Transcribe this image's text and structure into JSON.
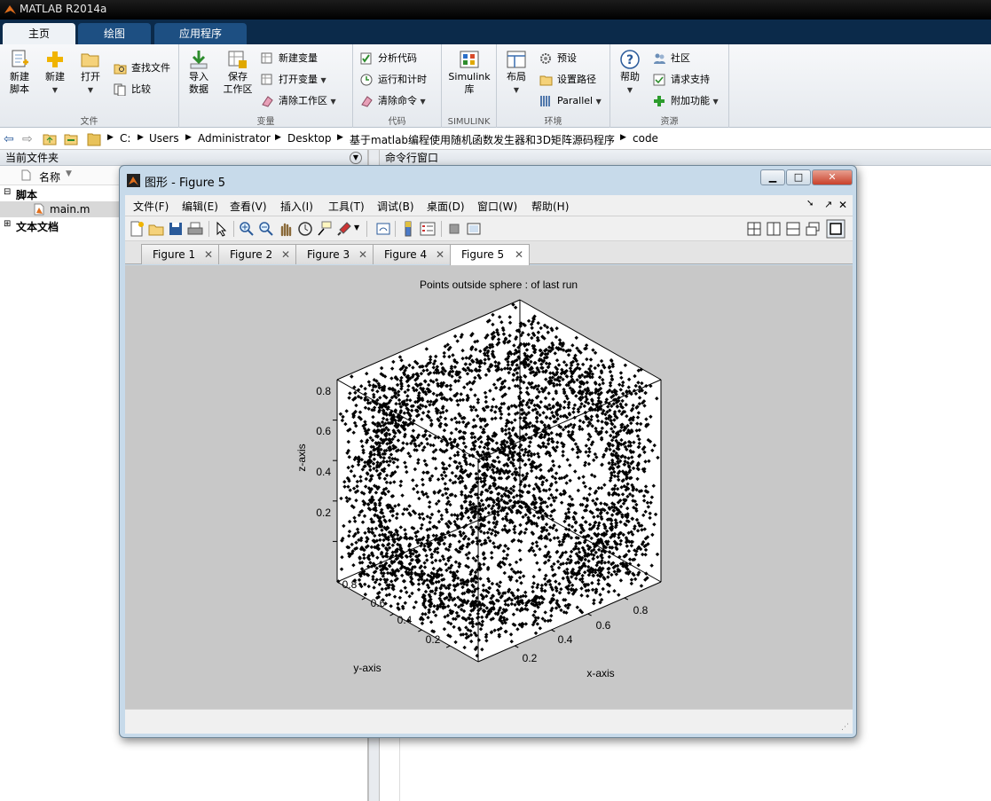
{
  "app": {
    "title": "MATLAB R2014a"
  },
  "ribbon": {
    "tabs": [
      "主页",
      "绘图",
      "应用程序"
    ],
    "groups": {
      "file": {
        "label": "文件",
        "new_script": "新建\n脚本",
        "new": "新建",
        "open": "打开",
        "find_files": "查找文件",
        "compare": "比较"
      },
      "variable": {
        "label": "变量",
        "import": "导入\n数据",
        "save": "保存\n工作区",
        "new_var": "新建变量",
        "open_var": "打开变量",
        "clear_ws": "清除工作区"
      },
      "code": {
        "label": "代码",
        "analyze": "分析代码",
        "run_time": "运行和计时",
        "clear_cmd": "清除命令"
      },
      "simulink": {
        "label": "SIMULINK",
        "library": "Simulink\n库"
      },
      "env": {
        "label": "环境",
        "layout": "布局",
        "prefs": "预设",
        "set_path": "设置路径",
        "parallel": "Parallel"
      },
      "resources": {
        "label": "资源",
        "help": "帮助",
        "community": "社区",
        "support": "请求支持",
        "addons": "附加功能"
      }
    }
  },
  "address": {
    "crumbs": [
      "C:",
      "Users",
      "Administrator",
      "Desktop",
      "基于matlab编程使用随机函数发生器和3D矩阵源码程序",
      "code"
    ]
  },
  "left_panel": {
    "title": "当前文件夹",
    "col_name": "名称",
    "folder_scripts": "脚本",
    "file_main": "main.m",
    "folder_docs": "文本文档"
  },
  "right_panel": {
    "title": "命令行窗口"
  },
  "figure_window": {
    "title": "图形 - Figure 5",
    "menu": [
      "文件(F)",
      "编辑(E)",
      "查看(V)",
      "插入(I)",
      "工具(T)",
      "调试(B)",
      "桌面(D)",
      "窗口(W)",
      "帮助(H)"
    ],
    "tabs": [
      "Figure 1",
      "Figure 2",
      "Figure 3",
      "Figure 4",
      "Figure 5"
    ],
    "active_tab": "Figure 5"
  },
  "chart_data": {
    "type": "scatter",
    "title": "Points outside sphere : of last run",
    "xlabel": "x-axis",
    "ylabel": "y-axis",
    "zlabel": "z-axis",
    "x_ticks": [
      "0.2",
      "0.4",
      "0.6",
      "0.8"
    ],
    "y_ticks": [
      "0.2",
      "0.4",
      "0.6",
      "0.8"
    ],
    "z_ticks": [
      "0.2",
      "0.4",
      "0.6",
      "0.8"
    ],
    "xlim": [
      0,
      1
    ],
    "ylim": [
      0,
      1
    ],
    "zlim": [
      0,
      1
    ],
    "marker_color": "#000000",
    "background": "#ffffff"
  }
}
